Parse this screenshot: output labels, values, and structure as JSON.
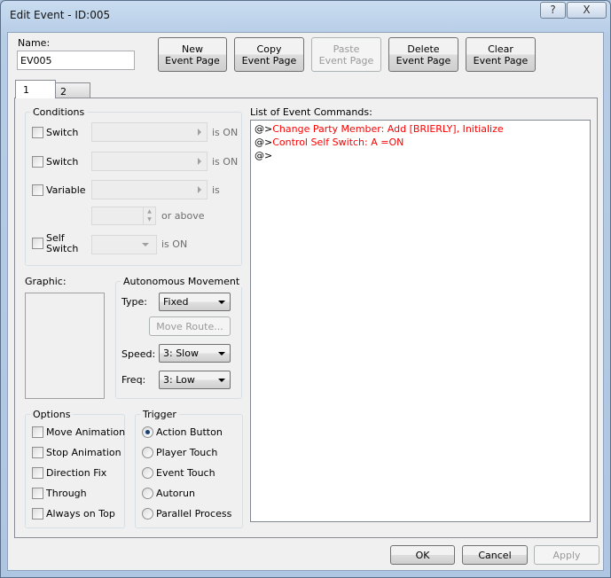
{
  "window": {
    "title": "Edit Event - ID:005",
    "help_label": "?",
    "close_label": "X"
  },
  "name": {
    "label": "Name:",
    "value": "EV005"
  },
  "toolbar": [
    {
      "line1": "New",
      "line2": "Event Page",
      "enabled": true
    },
    {
      "line1": "Copy",
      "line2": "Event Page",
      "enabled": true
    },
    {
      "line1": "Paste",
      "line2": "Event Page",
      "enabled": false
    },
    {
      "line1": "Delete",
      "line2": "Event Page",
      "enabled": true
    },
    {
      "line1": "Clear",
      "line2": "Event Page",
      "enabled": true
    }
  ],
  "tabs": [
    {
      "label": "1",
      "active": true
    },
    {
      "label": "2",
      "active": false
    }
  ],
  "conditions": {
    "title": "Conditions",
    "switch1_label": "Switch",
    "switch1_suffix": "is ON",
    "switch2_label": "Switch",
    "switch2_suffix": "is ON",
    "variable_label": "Variable",
    "variable_suffix": "is",
    "or_above": "or above",
    "self_switch_line1": "Self",
    "self_switch_line2": "Switch",
    "self_switch_suffix": "is ON"
  },
  "graphic": {
    "label": "Graphic:"
  },
  "movement": {
    "title": "Autonomous Movement",
    "type_label": "Type:",
    "type_value": "Fixed",
    "move_route": "Move Route...",
    "speed_label": "Speed:",
    "speed_value": "3: Slow",
    "freq_label": "Freq:",
    "freq_value": "3: Low"
  },
  "options": {
    "title": "Options",
    "items": [
      {
        "label": "Move Animation",
        "checked": false
      },
      {
        "label": "Stop Animation",
        "checked": false
      },
      {
        "label": "Direction Fix",
        "checked": false
      },
      {
        "label": "Through",
        "checked": false
      },
      {
        "label": "Always on Top",
        "checked": false
      }
    ]
  },
  "trigger": {
    "title": "Trigger",
    "selected": "Action Button",
    "items": [
      {
        "label": "Action Button"
      },
      {
        "label": "Player Touch"
      },
      {
        "label": "Event Touch"
      },
      {
        "label": "Autorun"
      },
      {
        "label": "Parallel Process"
      }
    ]
  },
  "commands": {
    "label": "List of Event Commands:",
    "items": [
      {
        "prefix": "@>",
        "text": "Change Party Member: Add [BRIERLY], Initialize"
      },
      {
        "prefix": "@>",
        "text": "Control Self Switch: A =ON"
      },
      {
        "prefix": "@>",
        "text": ""
      }
    ]
  },
  "footer": {
    "ok": "OK",
    "cancel": "Cancel",
    "apply": "Apply"
  },
  "colors": {
    "command_text": "#ff0000"
  }
}
